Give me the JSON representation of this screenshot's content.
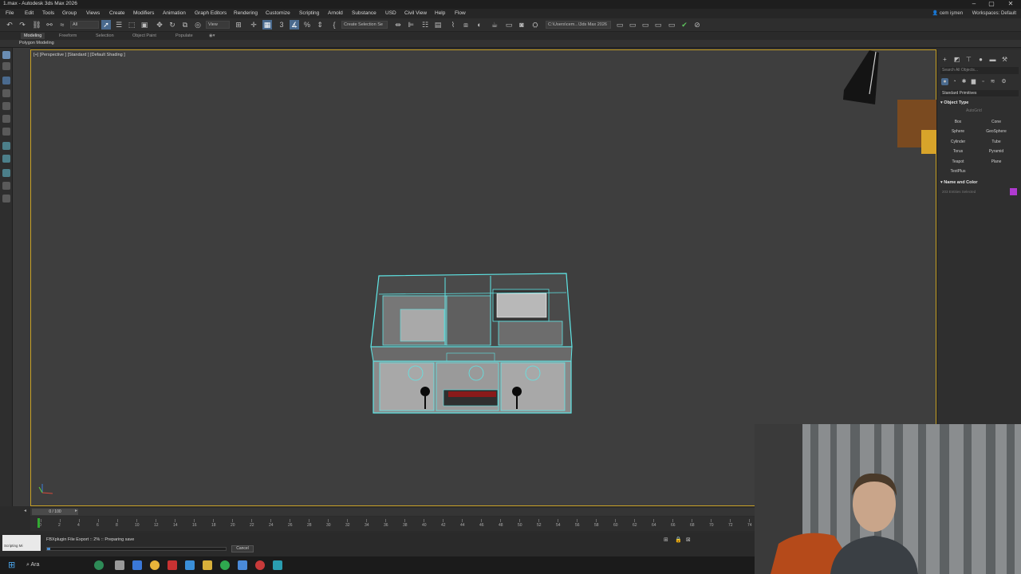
{
  "window": {
    "title": "1.max - Autodesk 3ds Max 2026"
  },
  "menu": [
    "File",
    "Edit",
    "Tools",
    "Group",
    "Views",
    "Create",
    "Modifiers",
    "Animation",
    "Graph Editors",
    "Rendering",
    "Customize",
    "Scripting",
    "Arnold",
    "Substance",
    "USD",
    "Civil View",
    "Help",
    "Flow"
  ],
  "user": {
    "name": "cem işmen",
    "workspaces_label": "Workspaces:",
    "workspace": "Default"
  },
  "toolbar": {
    "filter_dropdown": "All",
    "view_dropdown": "View",
    "selection_set": "Create Selection Se",
    "path": "C:\\Users\\cem...\\3ds Max 2026"
  },
  "ribbon": {
    "tabs": [
      "Modeling",
      "Freeform",
      "Selection",
      "Object Paint",
      "Populate"
    ],
    "active_tab": "Modeling",
    "panel_label": "Polygon Modeling"
  },
  "viewport": {
    "label": "[+] [Perspective ] [Standard ] [Default Shading ]"
  },
  "command_panel": {
    "search_placeholder": "Search All Objects...",
    "category": "Standard Primitives",
    "object_type_title": "Object Type",
    "autogrid": "AutoGrid",
    "primitives": [
      "Box",
      "Cone",
      "Sphere",
      "GeoSphere",
      "Cylinder",
      "Tube",
      "Torus",
      "Pyramid",
      "Teapot",
      "Plane",
      "TextPlus"
    ],
    "name_color_title": "Name and Color",
    "name_value": "203 Entities Selected",
    "selection_color": "#b03ad0"
  },
  "timeline": {
    "frame_display": "0 / 100",
    "tick_labels": [
      "0",
      "2",
      "4",
      "6",
      "8",
      "10",
      "12",
      "14",
      "16",
      "18",
      "20",
      "22",
      "24",
      "26",
      "28",
      "30",
      "32",
      "34",
      "36",
      "38",
      "40",
      "42",
      "44",
      "46",
      "48",
      "50",
      "52",
      "54",
      "56",
      "58",
      "60",
      "62",
      "64",
      "66",
      "68",
      "70",
      "72",
      "74"
    ]
  },
  "status": {
    "message": "FBXplugin File Export :: 2% :: Preparing save",
    "progress": 0.02,
    "cancel_label": "Cancel",
    "maxscript_label": "Scripting Mi"
  },
  "taskbar": {
    "search_label": "Ara"
  },
  "accent": {
    "selection_wire": "#5fe6e6",
    "viewport_border": "#c9a227",
    "active_blue": "#4a6a8e"
  }
}
